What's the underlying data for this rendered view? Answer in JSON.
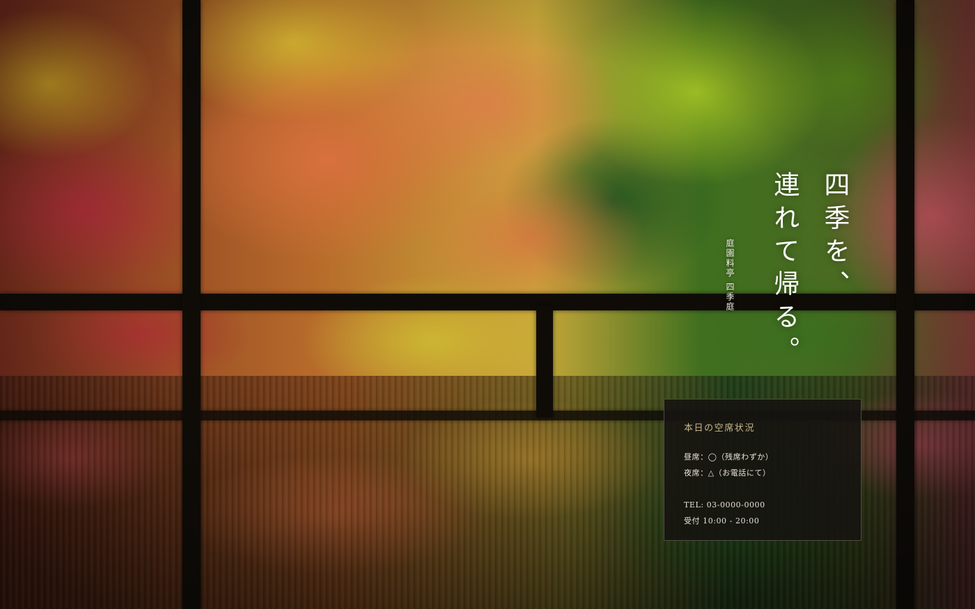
{
  "hero": {
    "catch_line_1": "四季を、",
    "catch_line_2": "連れて帰る。",
    "subtitle": "庭園料亭 四季庭"
  },
  "availability": {
    "title": "本日の空席状況",
    "lunch": "昼席：◯（残席わずか）",
    "dinner": "夜席：△（お電話にて）",
    "tel": "TEL: 03-0000-0000",
    "hours": "受付 10:00 - 20:00"
  },
  "colors": {
    "panel_background": "#161411",
    "panel_title": "#cbb68c",
    "frame": "#0f0c08"
  }
}
